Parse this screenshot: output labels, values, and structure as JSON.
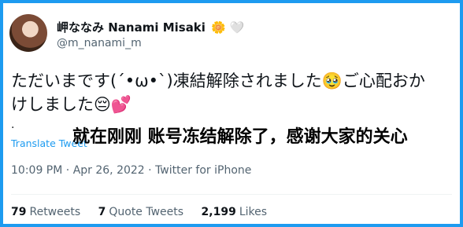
{
  "user": {
    "name": "岬ななみ Nanami Misaki",
    "name_emojis": "🌼 🤍",
    "handle": "@m_nanami_m"
  },
  "tweet": {
    "text_line1": "ただいまです(ˊ•ω•ˋ)凍結解除されました🥹ご心配おか",
    "text_line2": "けしました😔💕",
    "dot": "."
  },
  "overlay_caption": "就在刚刚 账号冻结解除了，感谢大家的关心",
  "translate_link": "Translate Tweet",
  "meta": {
    "time": "10:09 PM",
    "date": "Apr 26, 2022",
    "source": "Twitter for iPhone",
    "separator": "·"
  },
  "stats": {
    "retweets_count": "79",
    "retweets_label": "Retweets",
    "quotes_count": "7",
    "quotes_label": "Quote Tweets",
    "likes_count": "2,199",
    "likes_label": "Likes"
  },
  "colors": {
    "frame": "#1d9bf0",
    "link": "#1d9bf0",
    "text": "#0f1419",
    "muted": "#536471"
  }
}
